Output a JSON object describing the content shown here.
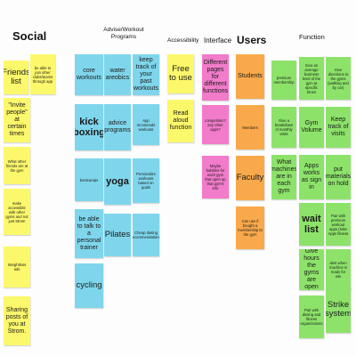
{
  "headers": {
    "social": "Social",
    "advise": "Advise/Workout\nPrograms",
    "accessibility": "Accessibility",
    "interface": "Interface",
    "users": "Users",
    "function": "Function"
  },
  "colors": {
    "yellow": "#fcf86b",
    "cyan": "#7fd6ec",
    "orange": "#f9a94b",
    "pink": "#f27bca",
    "green": "#8de36a"
  },
  "notes": {
    "social": [
      "Friends list",
      "be able to join other clubs/teams through app",
      "\"Invite people\" at certain times",
      "What other friends are at the gym",
      "make accessible with other gyms and not just Strom",
      "Weightloss ads",
      "Sharing posts of you at Strom."
    ],
    "advise": [
      "core workouts",
      "water areobics",
      "keep track of your past workouts",
      "kick boxing",
      "advice programs",
      "App recomends workouts",
      "bootcamps",
      "yoga",
      "Personalize workouts based on goals",
      "be able to talk to a personal trainer",
      "Pilates",
      "Cheap dieting recommendations",
      "cycling"
    ],
    "accessibility": [
      "Free to use",
      "Read aloud function"
    ],
    "interface": [
      "Different pages for different functions",
      "competition? any other apps?",
      "Maybe bubbles for each gym that open up that gym's info"
    ],
    "users": [
      "Students",
      "Members",
      "Faculty",
      "Can use if bought a membership to the gym"
    ],
    "function": [
      "premium membership",
      "Give an average business level of the gym at specific times",
      "Give directions to the gyms (walking and by car)",
      "Give a breakdown of monthly visits",
      "Gym Volume",
      "Keep track of visits",
      "What machines are in each gym",
      "Apps works as sign in",
      "put materials on hold",
      "wait list",
      "Pair with premium workout apps (Nike Apps fitness",
      "Give hours the gyms are open",
      "alert when machine is ready for use",
      "Pair with dieting and fitness organizations",
      "Strike system"
    ]
  }
}
